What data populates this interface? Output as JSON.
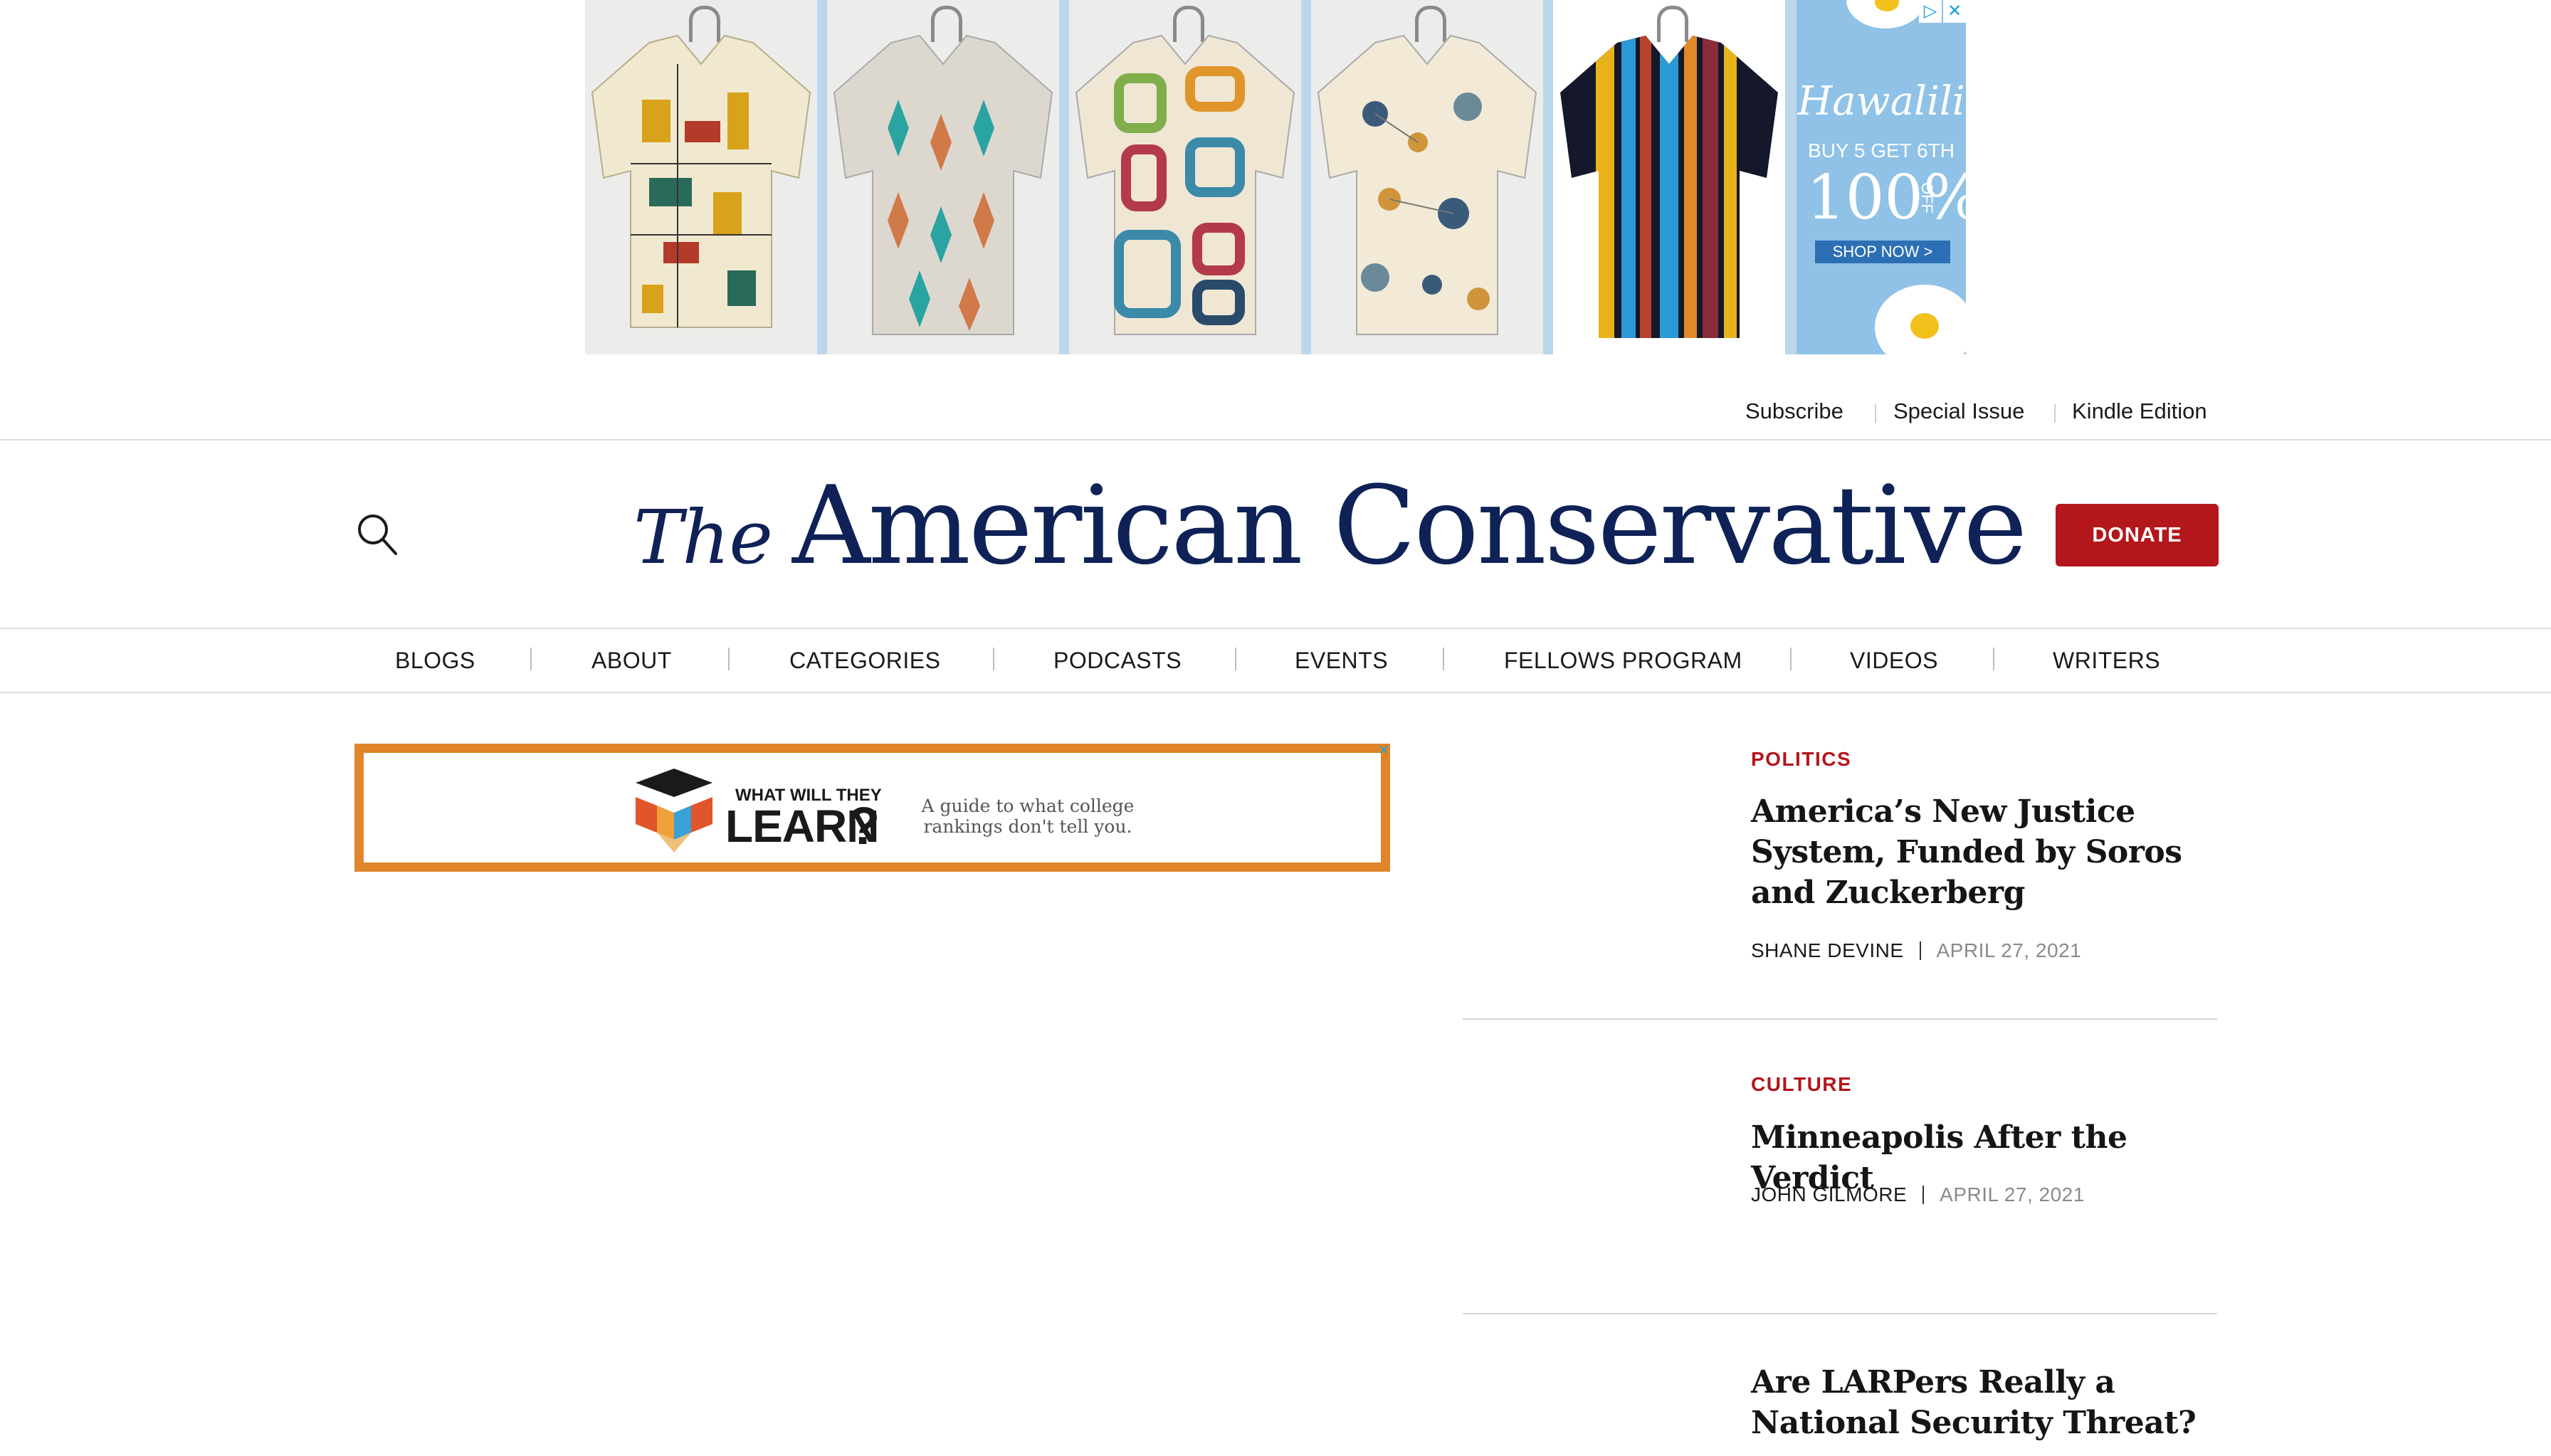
{
  "top_ad": {
    "brand": "Hawalili",
    "offer": "BUY 5 GET 6TH",
    "big": "100%",
    "off": "OFF",
    "cta": "SHOP NOW >",
    "adchoices_icon": "adchoices-icon",
    "close_icon": "close-icon"
  },
  "utility_links": [
    "Subscribe",
    "Special Issue",
    "Kindle Edition"
  ],
  "masthead": {
    "logo_the": "The",
    "logo_name": "American Conservative",
    "search_icon": "search-icon",
    "donate_label": "DONATE"
  },
  "nav": [
    "BLOGS",
    "ABOUT",
    "CATEGORIES",
    "PODCASTS",
    "EVENTS",
    "FELLOWS PROGRAM",
    "VIDEOS",
    "WRITERS"
  ],
  "inline_ad": {
    "small": "WHAT WILL THEY",
    "big": "LEARN",
    "question_mark": "?",
    "tagline": "A guide to what college rankings don't tell you.",
    "close_icon": "close-icon"
  },
  "articles": [
    {
      "category": "POLITICS",
      "title": "America’s New Justice System, Funded by Soros and Zuckerberg",
      "author": "SHANE DEVINE",
      "date": "APRIL 27, 2021"
    },
    {
      "category": "CULTURE",
      "title": "Minneapolis After the Verdict",
      "author": "JOHN GILMORE",
      "date": "APRIL 27, 2021"
    },
    {
      "category": "",
      "title": "Are LARPers Really a National Security Threat?",
      "author": "",
      "date": ""
    }
  ],
  "colors": {
    "brand_navy": "#0f2257",
    "accent_red": "#b3161b",
    "ad_orange": "#e0852a",
    "ad_blue": "#8fc2e6"
  }
}
